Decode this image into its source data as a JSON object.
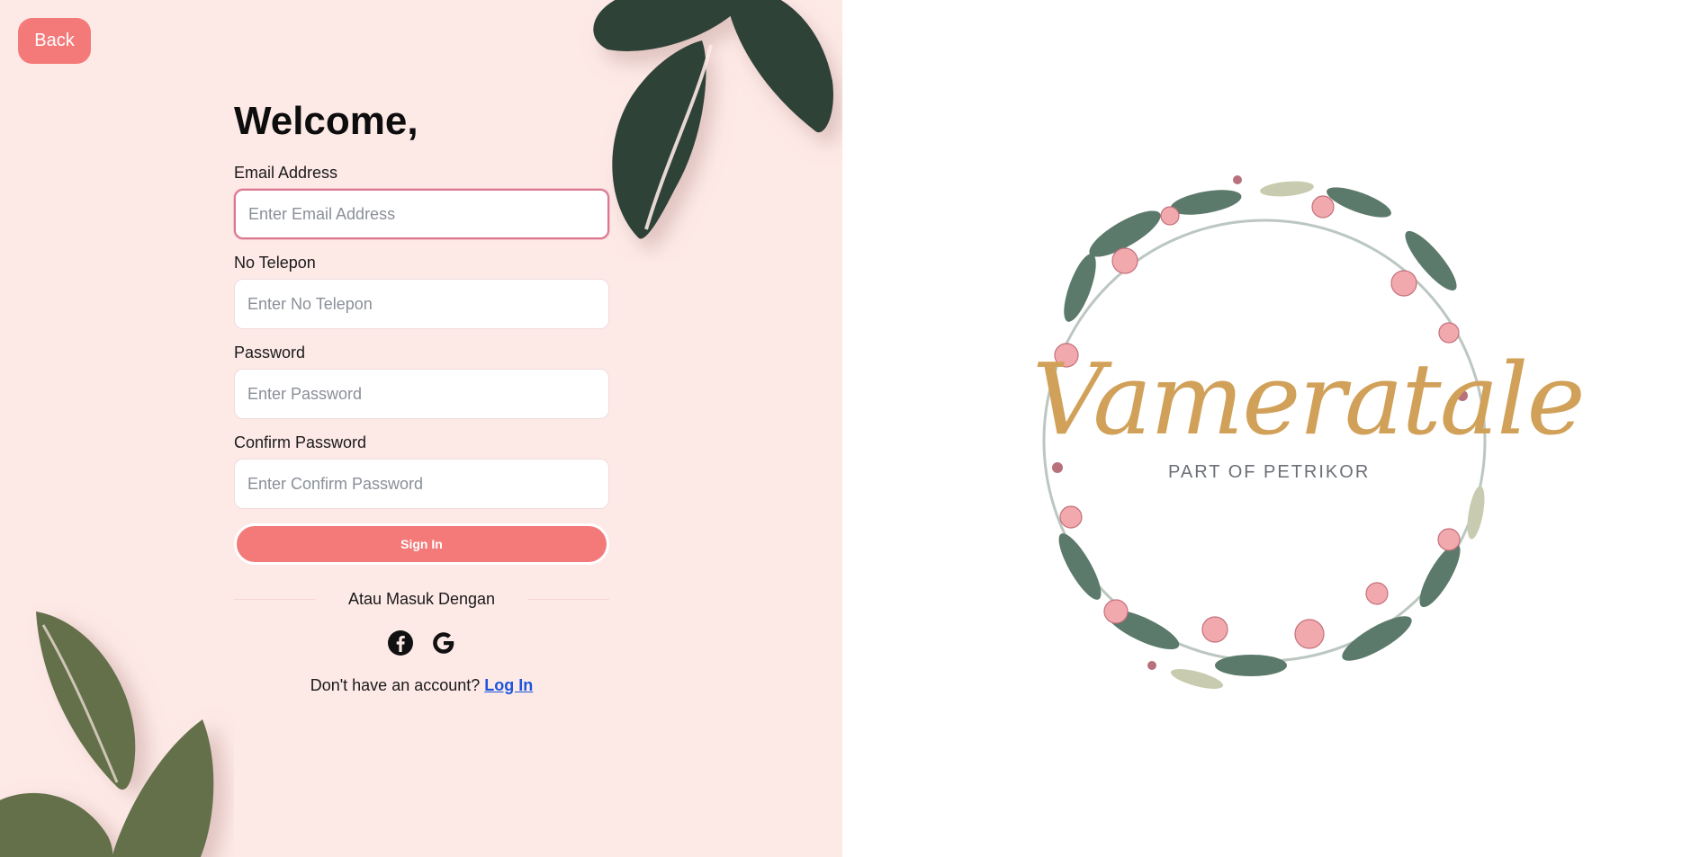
{
  "nav": {
    "back_label": "Back"
  },
  "form": {
    "title": "Welcome,",
    "fields": [
      {
        "label": "Email Address",
        "placeholder": "Enter Email Address",
        "value": ""
      },
      {
        "label": "No Telepon",
        "placeholder": "Enter No Telepon",
        "value": ""
      },
      {
        "label": "Password",
        "placeholder": "Enter Password",
        "value": ""
      },
      {
        "label": "Confirm Password",
        "placeholder": "Enter Confirm Password",
        "value": ""
      }
    ],
    "submit_label": "Sign In",
    "divider_text": "Atau Masuk Dengan",
    "social": [
      "facebook-icon",
      "google-icon"
    ],
    "signup_prompt": "Don't have an account?",
    "signup_link": "Log In"
  },
  "brand": {
    "name": "Vameratale",
    "tagline": "PART OF PETRIKOR"
  },
  "colors": {
    "panel_bg": "#fde9e6",
    "accent": "#f47a7a",
    "leaf_dark": "#2f4339",
    "leaf_olive": "#63704a",
    "logo_gold": "#d1a15a",
    "link": "#1a56db"
  }
}
